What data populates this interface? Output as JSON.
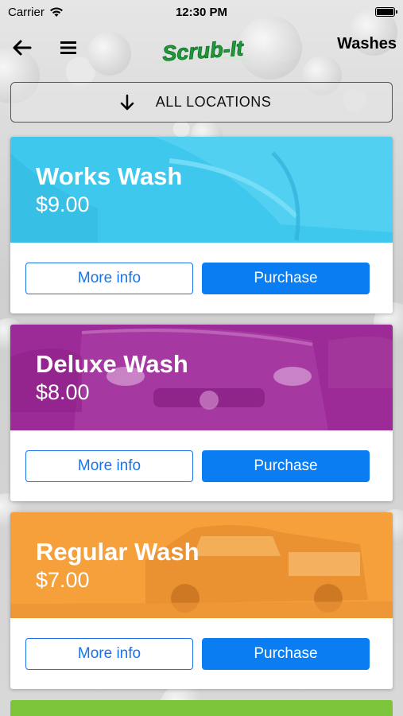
{
  "status_bar": {
    "carrier": "Carrier",
    "time": "12:30 PM"
  },
  "nav": {
    "logo_text": "Scrub-It",
    "title": "Washes"
  },
  "location_selector": {
    "label": "ALL LOCATIONS"
  },
  "washes": [
    {
      "name": "Works Wash",
      "price": "$9.00",
      "color": "#3ec8ee",
      "more_info_label": "More info",
      "purchase_label": "Purchase"
    },
    {
      "name": "Deluxe Wash",
      "price": "$8.00",
      "color": "#9c2a97",
      "more_info_label": "More info",
      "purchase_label": "Purchase"
    },
    {
      "name": "Regular Wash",
      "price": "$7.00",
      "color": "#f6a03c",
      "more_info_label": "More info",
      "purchase_label": "Purchase"
    }
  ],
  "colors": {
    "primary_blue": "#0a7df2",
    "logo_green": "#1f9a3a",
    "next_card": "#7cc53a"
  },
  "icons": {
    "back": "arrow-left-icon",
    "menu": "hamburger-menu-icon",
    "location": "arrow-down-icon"
  }
}
